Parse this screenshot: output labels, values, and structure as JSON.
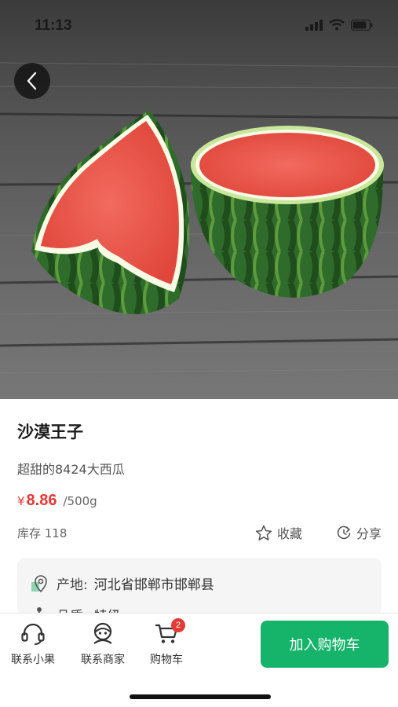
{
  "status_bar": {
    "time": "11:13"
  },
  "product": {
    "title": "沙漠王子",
    "subtitle": "超甜的8424大西瓜",
    "currency": "¥",
    "price": "8.86",
    "unit": "/500g",
    "stock": "库存 118",
    "favorite_label": "收藏",
    "share_label": "分享",
    "origin_label": "产地:",
    "origin_value": "河北省邯郸市邯郸县",
    "grade_label": "品质:",
    "grade_value": "特级"
  },
  "bottom_bar": {
    "tabs": [
      {
        "label": "联系小果",
        "icon": "headset-icon"
      },
      {
        "label": "联系商家",
        "icon": "merchant-service-icon"
      },
      {
        "label": "购物车",
        "icon": "cart-icon",
        "badge": "2"
      }
    ],
    "add_to_cart": "加入购物车"
  },
  "colors": {
    "accent": "#16b36b",
    "price": "#e53935"
  }
}
